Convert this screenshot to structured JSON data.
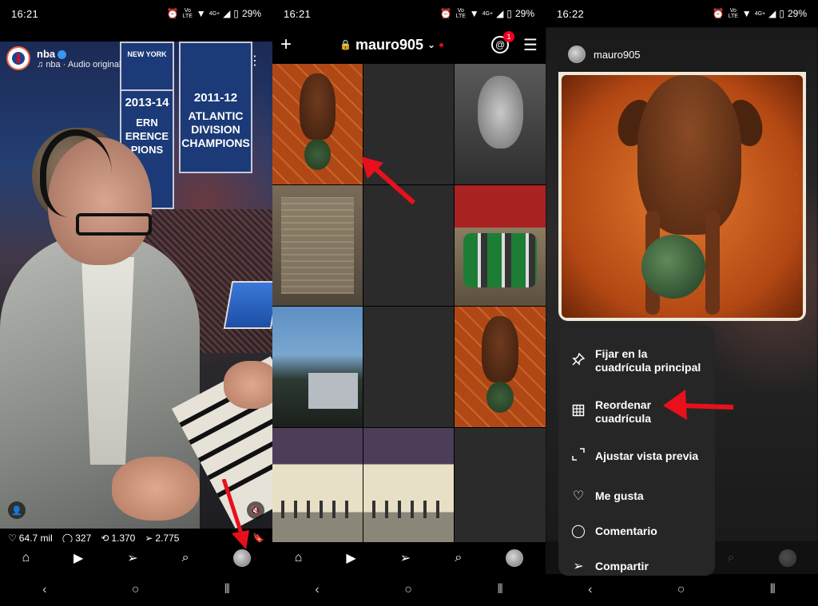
{
  "panels": [
    {
      "status_time": "16:21",
      "battery": "29%"
    },
    {
      "status_time": "16:21",
      "battery": "29%"
    },
    {
      "status_time": "16:22",
      "battery": "29%"
    }
  ],
  "status_icons": {
    "volte": "Vo LTE",
    "network": "4G+"
  },
  "reel": {
    "account": "nba",
    "audio": "nba · Audio original",
    "banner_year_1": "2013-14",
    "banner_1_lines": "ERN ERENCE PIONS",
    "banner_year_2": "2011-12",
    "banner_2_lines": "ATLANTIC DIVISION CHAMPIONS",
    "banner_3": "NEW YORK",
    "likes": "64.7 mil",
    "comments": "327",
    "reposts": "1.370",
    "shares": "2.775"
  },
  "profile": {
    "username": "mauro905",
    "threads_badge": "1"
  },
  "post": {
    "username": "mauro905"
  },
  "context_menu": {
    "items": [
      {
        "label": "Fijar en la cuadrícula principal",
        "icon": "pin-icon"
      },
      {
        "label": "Reordenar cuadrícula",
        "icon": "grid-icon"
      },
      {
        "label": "Ajustar vista previa",
        "icon": "crop-icon"
      },
      {
        "label": "Me gusta",
        "icon": "heart-icon"
      },
      {
        "label": "Comentario",
        "icon": "comment-icon"
      },
      {
        "label": "Compartir",
        "icon": "share-icon"
      }
    ]
  },
  "colors": {
    "arrow": "#e8101c",
    "accent": "#3897f0",
    "badge": "#e02222"
  }
}
